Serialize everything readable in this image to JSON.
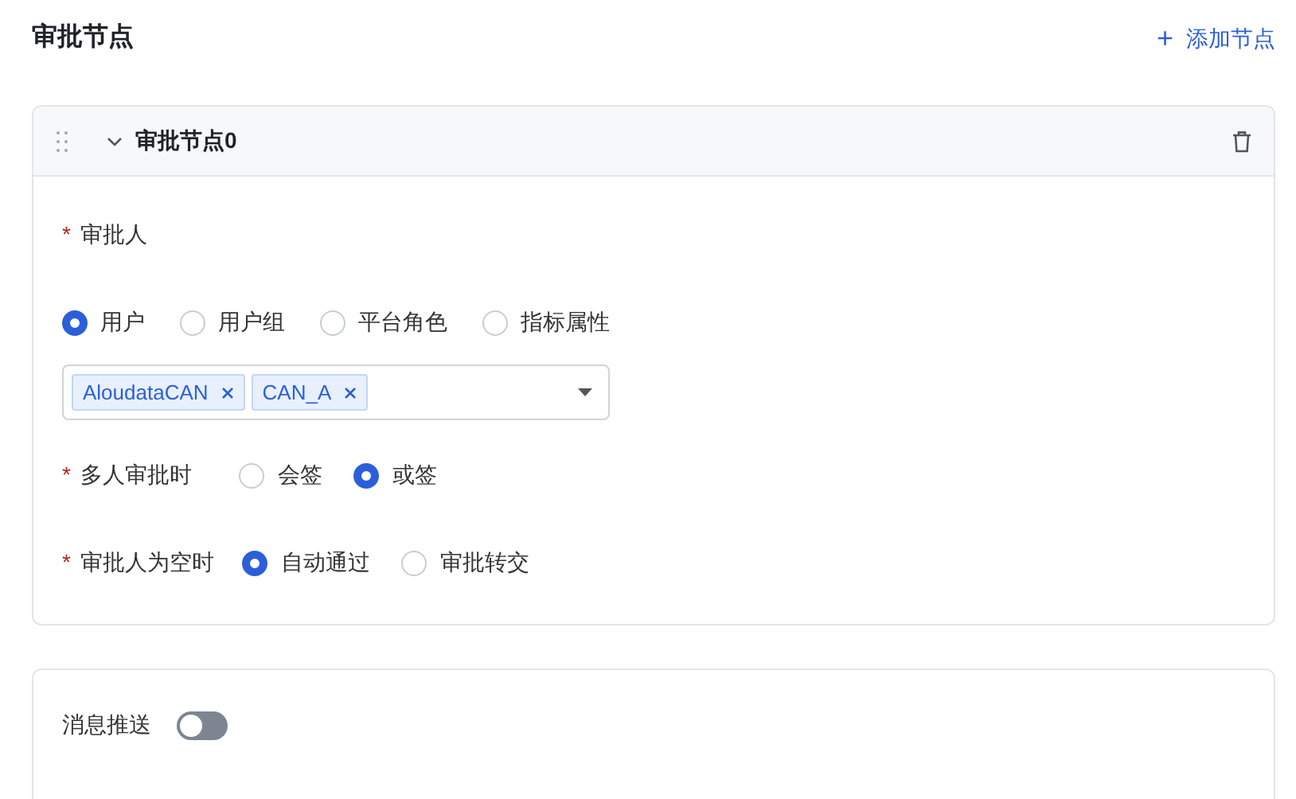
{
  "header": {
    "title": "审批节点",
    "add_button": {
      "icon": "+",
      "label": "添加节点"
    }
  },
  "node": {
    "title": "审批节点0",
    "expanded": true,
    "approver": {
      "mark": "*",
      "label": "审批人",
      "options": [
        {
          "label": "用户",
          "selected": true
        },
        {
          "label": "用户组",
          "selected": false
        },
        {
          "label": "平台角色",
          "selected": false
        },
        {
          "label": "指标属性",
          "selected": false
        }
      ],
      "tags": [
        "AloudataCAN",
        "CAN_A"
      ]
    },
    "fields": [
      {
        "mark": "*",
        "label": "多人审批时",
        "options": [
          {
            "label": "会签",
            "selected": false
          },
          {
            "label": "或签",
            "selected": true
          }
        ]
      },
      {
        "mark": "*",
        "label": "审批人为空时",
        "options": [
          {
            "label": "自动通过",
            "selected": true
          },
          {
            "label": "审批转交",
            "selected": false
          }
        ]
      }
    ]
  },
  "notify": {
    "label": "消息推送",
    "on": false
  }
}
